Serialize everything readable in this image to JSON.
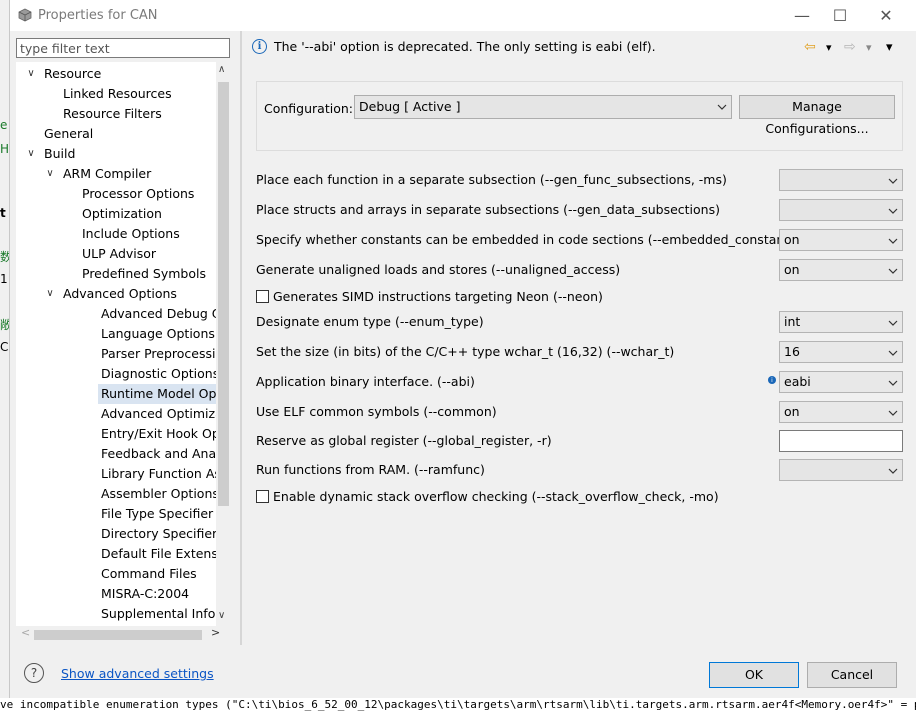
{
  "window": {
    "title": "Properties for CAN",
    "minimize": "—",
    "maximize": "☐",
    "close": "✕"
  },
  "filter": {
    "placeholder": "type filter text"
  },
  "tree": [
    {
      "label": "Resource",
      "toggle": "∨"
    },
    {
      "label": "Linked Resources"
    },
    {
      "label": "Resource Filters"
    },
    {
      "label": "General"
    },
    {
      "label": "Build",
      "toggle": "∨"
    },
    {
      "label": "ARM Compiler",
      "toggle": "∨"
    },
    {
      "label": "Processor Options"
    },
    {
      "label": "Optimization"
    },
    {
      "label": "Include Options"
    },
    {
      "label": "ULP Advisor"
    },
    {
      "label": "Predefined Symbols"
    },
    {
      "label": "Advanced Options",
      "toggle": "∨"
    },
    {
      "label": "Advanced Debug Op"
    },
    {
      "label": "Language Options"
    },
    {
      "label": "Parser Preprocessing"
    },
    {
      "label": "Diagnostic Options"
    },
    {
      "label": "Runtime Model Opti"
    },
    {
      "label": "Advanced Optimizat"
    },
    {
      "label": "Entry/Exit Hook Opti"
    },
    {
      "label": "Feedback and Analy"
    },
    {
      "label": "Library Function Assu"
    },
    {
      "label": "Assembler Options"
    },
    {
      "label": "File Type Specifier"
    },
    {
      "label": "Directory Specifier"
    },
    {
      "label": "Default File Extensio"
    },
    {
      "label": "Command Files"
    },
    {
      "label": "MISRA-C:2004"
    },
    {
      "label": "Supplemental Inforn"
    }
  ],
  "scroll": {
    "up": "∧",
    "down": "∨",
    "left": "<",
    "right": ">"
  },
  "info": {
    "icon_text": "i",
    "message": "The '--abi' option is deprecated.  The only setting is eabi (elf)."
  },
  "nav": {
    "back": "⇦",
    "forward": "⇨",
    "dropdown": "▾"
  },
  "configuration": {
    "label": "Configuration:",
    "value": "Debug  [ Active ]",
    "manage": "Manage Configurations..."
  },
  "options": [
    {
      "label": "Place each function in a separate subsection (--gen_func_subsections, -ms)",
      "kind": "combo",
      "value": ""
    },
    {
      "label": "Place structs and arrays in separate subsections (--gen_data_subsections)",
      "kind": "combo",
      "value": ""
    },
    {
      "label": "Specify whether constants can be embedded in code sections (--embedded_constants)",
      "kind": "combo",
      "value": "on"
    },
    {
      "label": "Generate unaligned loads and stores (--unaligned_access)",
      "kind": "combo",
      "value": "on"
    },
    {
      "label": "Generates SIMD instructions targeting Neon (--neon)",
      "kind": "checkbox"
    },
    {
      "label": "Designate enum type (--enum_type)",
      "kind": "combo",
      "value": "int"
    },
    {
      "label": "Set the size (in bits) of the C/C++ type wchar_t (16,32) (--wchar_t)",
      "kind": "combo",
      "value": "16"
    },
    {
      "label": "Application binary interface. (--abi)",
      "kind": "combo",
      "value": "eabi"
    },
    {
      "label": "Use ELF common symbols (--common)",
      "kind": "combo",
      "value": "on"
    },
    {
      "label": "Reserve as global register (--global_register, -r)",
      "kind": "text",
      "value": ""
    },
    {
      "label": "Run functions from RAM. (--ramfunc)",
      "kind": "combo",
      "value": ""
    },
    {
      "label": "Enable dynamic stack overflow checking (--stack_overflow_check, -mo)",
      "kind": "checkbox"
    }
  ],
  "bottom": {
    "help": "?",
    "advanced_link": "Show advanced settings",
    "ok": "OK",
    "cancel": "Cancel"
  },
  "background": {
    "left_chars": [
      "e",
      "H",
      "t",
      "数",
      "1",
      "敞",
      "C"
    ],
    "bottom_text": "ve incompatible enumeration types (\"C:\\ti\\bios_6_52_00_12\\packages\\ti\\targets\\arm\\rtsarm\\lib\\ti.targets.arm.rtsarm.aer4f<Memory.oer4f>\" = packed, \"./App"
  },
  "colors": {
    "accent": "#0078d7",
    "link": "#0b55c4",
    "selection": "#d9e4f1"
  }
}
